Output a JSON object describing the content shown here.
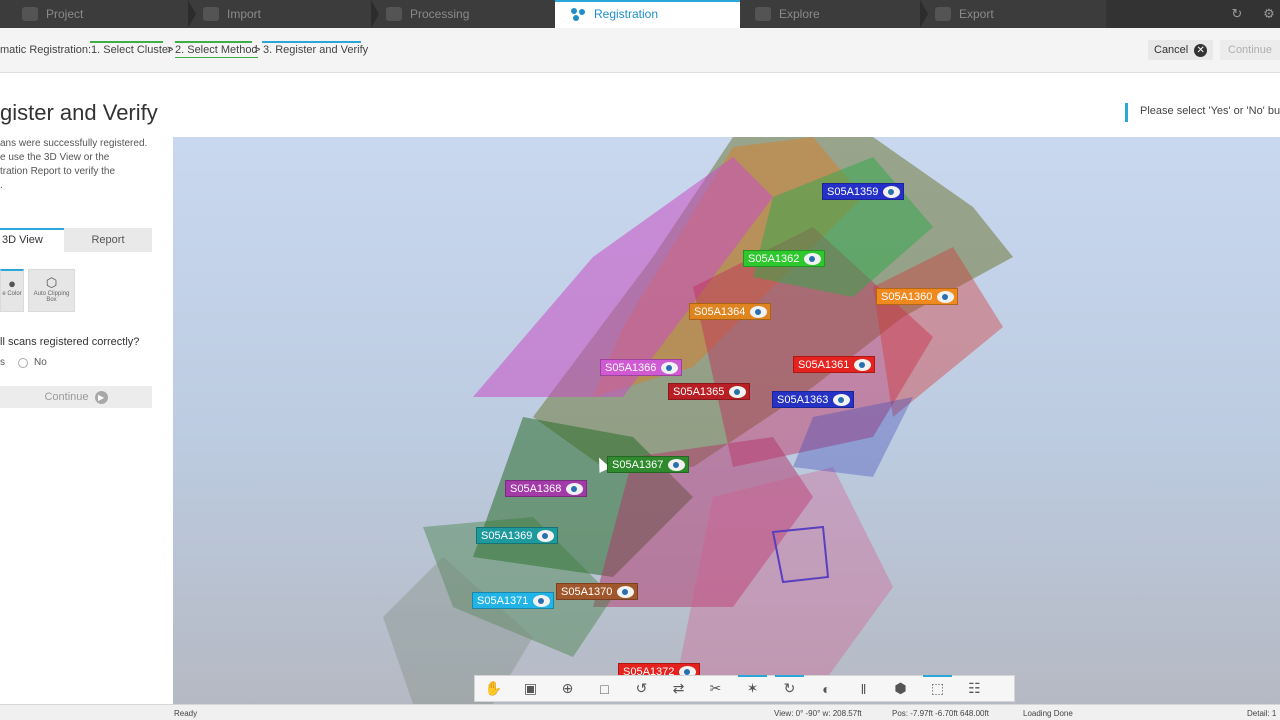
{
  "workflow": {
    "steps": [
      {
        "label": "Project",
        "icon": "folder-icon"
      },
      {
        "label": "Import",
        "icon": "import-icon"
      },
      {
        "label": "Processing",
        "icon": "processing-icon"
      },
      {
        "label": "Registration",
        "icon": "registration-icon",
        "active": true
      },
      {
        "label": "Explore",
        "icon": "explore-icon"
      },
      {
        "label": "Export",
        "icon": "export-icon"
      }
    ]
  },
  "breadcrumb": {
    "title": "matic Registration:",
    "steps": [
      "1. Select Cluster",
      "2. Select Method",
      "3. Register and Verify"
    ],
    "separator": ">"
  },
  "actions": {
    "cancel": "Cancel",
    "continue": "Continue"
  },
  "panel": {
    "title": "gister and Verify",
    "desc_lines": [
      "ans were successfully registered.",
      "e use the 3D View or the",
      "tration Report to verify the",
      "."
    ],
    "tabs": [
      "3D View",
      "Report"
    ],
    "tools": [
      {
        "label": "e Color"
      },
      {
        "label": "Auto Clipping Box"
      }
    ],
    "question": "ll scans registered correctly?",
    "options": [
      "s",
      "No"
    ],
    "continue": "Continue"
  },
  "hint": "Please select 'Yes' or 'No' butto",
  "scans": [
    {
      "name": "S05A1359",
      "color": "#2430c8"
    },
    {
      "name": "S05A1362",
      "color": "#2ec72e"
    },
    {
      "name": "S05A1360",
      "color": "#f08a1e"
    },
    {
      "name": "S05A1364",
      "color": "#e0841f"
    },
    {
      "name": "S05A1366",
      "color": "#d05ad3"
    },
    {
      "name": "S05A1361",
      "color": "#e5221e"
    },
    {
      "name": "S05A1365",
      "color": "#b81f24"
    },
    {
      "name": "S05A1363",
      "color": "#2532c4"
    },
    {
      "name": "S05A1367",
      "color": "#2f8a2e"
    },
    {
      "name": "S05A1368",
      "color": "#a23aa8"
    },
    {
      "name": "S05A1369",
      "color": "#1f9a9c"
    },
    {
      "name": "S05A1370",
      "color": "#a0572c"
    },
    {
      "name": "S05A1371",
      "color": "#22b4e6"
    },
    {
      "name": "S05A1372",
      "color": "#e5221e"
    }
  ],
  "toolbar": {
    "buttons": [
      "navigate-icon",
      "view-cube-icon",
      "zoom-icon",
      "box-icon",
      "rotate-icon",
      "move-icon",
      "clip-icon",
      "scan-icon",
      "refresh-icon",
      "split-icon",
      "columns-icon",
      "cube-icon",
      "fit-icon",
      "grid-icon"
    ]
  },
  "status": {
    "ready": "Ready",
    "view": "View: 0° -90° w: 208.57ft",
    "pos": "Pos: -7.97ft -6.70ft 648.00ft",
    "loading": "Loading Done",
    "detail": "Detail: 1"
  }
}
